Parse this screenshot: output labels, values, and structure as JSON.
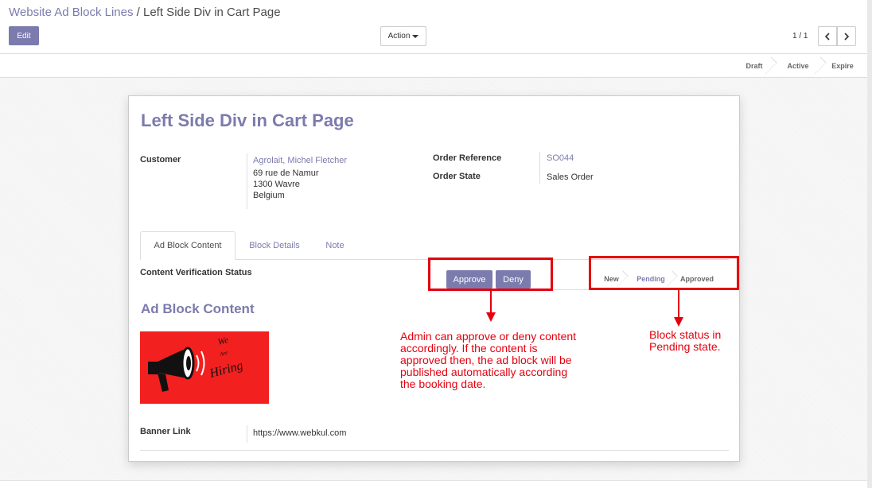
{
  "breadcrumb": {
    "parent": "Website Ad Block Lines",
    "separator": "/",
    "current": "Left Side Div in Cart Page"
  },
  "toolbar": {
    "edit_label": "Edit",
    "action_label": "Action"
  },
  "pager": {
    "value": "1 / 1"
  },
  "statusbar": {
    "steps": [
      "Draft",
      "Active",
      "Expire"
    ]
  },
  "record": {
    "title": "Left Side Div in Cart Page",
    "customer_label": "Customer",
    "customer_name": "Agrolait, Michel Fletcher",
    "customer_address": [
      "69 rue de Namur",
      "1300 Wavre",
      "Belgium"
    ],
    "order_reference_label": "Order Reference",
    "order_reference": "SO044",
    "order_state_label": "Order State",
    "order_state": "Sales Order"
  },
  "tabs": [
    {
      "label": "Ad Block Content",
      "active": true
    },
    {
      "label": "Block Details",
      "active": false
    },
    {
      "label": "Note",
      "active": false
    }
  ],
  "verification": {
    "label": "Content Verification Status",
    "approve_label": "Approve",
    "deny_label": "Deny",
    "steps": [
      "New",
      "Pending",
      "Approved"
    ],
    "current_step": "Pending"
  },
  "ad_content": {
    "section_title": "Ad Block Content",
    "banner_text": [
      "We",
      "Are",
      "Hiring"
    ],
    "banner_link_label": "Banner Link",
    "banner_link": "https://www.webkul.com"
  },
  "annotations": {
    "approve_note": "Admin can approve or deny content accordingly. If the content is approved then, the ad block will be published automatically according the booking date.",
    "status_note": "Block status in Pending state."
  },
  "colors": {
    "primary": "#7c7bad",
    "annotation_red": "#e5000f",
    "banner_red": "#f2201f"
  }
}
